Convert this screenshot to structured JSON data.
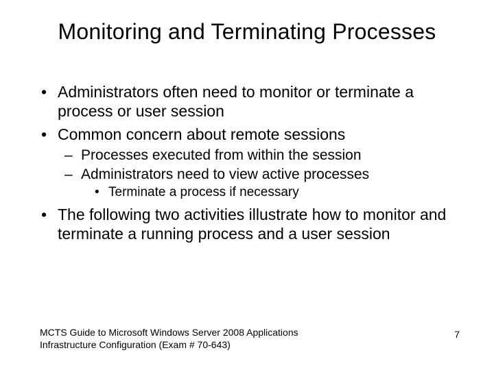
{
  "title": "Monitoring and Terminating Processes",
  "bullets": {
    "b1": "Administrators often need to monitor or terminate a process or user session",
    "b2": "Common concern about remote sessions",
    "b2a": "Processes executed from within the session",
    "b2b": "Administrators need to view active processes",
    "b2b1": "Terminate a process if necessary",
    "b3": "The following two activities illustrate how to monitor and terminate a running process and a user session"
  },
  "footer": {
    "left_line1": "MCTS Guide to Microsoft Windows Server 2008 Applications",
    "left_line2": "Infrastructure Configuration (Exam # 70-643)",
    "page": "7"
  }
}
